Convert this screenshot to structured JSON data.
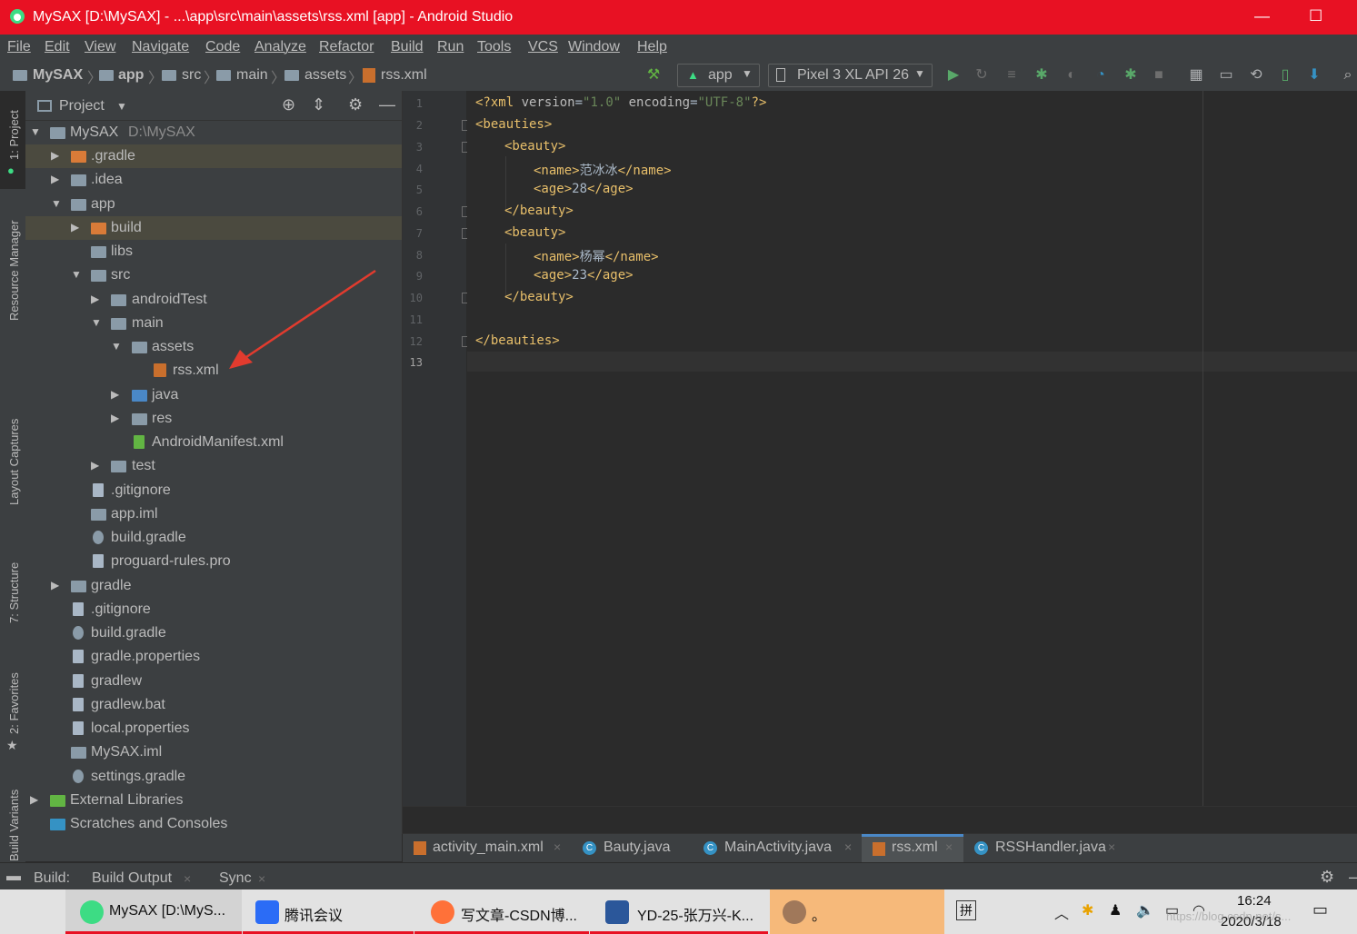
{
  "window": {
    "title": "MySAX [D:\\MySAX] - ...\\app\\src\\main\\assets\\rss.xml [app] - Android Studio",
    "minimize": "—",
    "maximize": "☐"
  },
  "menu": [
    "File",
    "Edit",
    "View",
    "Navigate",
    "Code",
    "Analyze",
    "Refactor",
    "Build",
    "Run",
    "Tools",
    "VCS",
    "Window",
    "Help"
  ],
  "breadcrumbs": [
    "MySAX",
    "app",
    "src",
    "main",
    "assets",
    "rss.xml"
  ],
  "toolbar": {
    "config": "app",
    "device": "Pixel 3 XL API 26"
  },
  "left_strip": [
    "1: Project",
    "Resource Manager",
    "Layout Captures",
    "7: Structure",
    "2: Favorites",
    "Build Variants"
  ],
  "project_panel": {
    "title": "Project"
  },
  "tree": [
    {
      "label": "MySAX",
      "sub": "D:\\MySAX",
      "arrow": "▼"
    },
    {
      "label": ".gradle",
      "arrow": "▶"
    },
    {
      "label": ".idea",
      "arrow": "▶"
    },
    {
      "label": "app",
      "arrow": "▼"
    },
    {
      "label": "build",
      "arrow": "▶"
    },
    {
      "label": "libs",
      "arrow": ""
    },
    {
      "label": "src",
      "arrow": "▼"
    },
    {
      "label": "androidTest",
      "arrow": "▶"
    },
    {
      "label": "main",
      "arrow": "▼"
    },
    {
      "label": "assets",
      "arrow": "▼"
    },
    {
      "label": "rss.xml",
      "arrow": ""
    },
    {
      "label": "java",
      "arrow": "▶"
    },
    {
      "label": "res",
      "arrow": "▶"
    },
    {
      "label": "AndroidManifest.xml",
      "arrow": ""
    },
    {
      "label": "test",
      "arrow": "▶"
    },
    {
      "label": ".gitignore",
      "arrow": ""
    },
    {
      "label": "app.iml",
      "arrow": ""
    },
    {
      "label": "build.gradle",
      "arrow": ""
    },
    {
      "label": "proguard-rules.pro",
      "arrow": ""
    },
    {
      "label": "gradle",
      "arrow": "▶"
    },
    {
      "label": ".gitignore",
      "arrow": ""
    },
    {
      "label": "build.gradle",
      "arrow": ""
    },
    {
      "label": "gradle.properties",
      "arrow": ""
    },
    {
      "label": "gradlew",
      "arrow": ""
    },
    {
      "label": "gradlew.bat",
      "arrow": ""
    },
    {
      "label": "local.properties",
      "arrow": ""
    },
    {
      "label": "MySAX.iml",
      "arrow": ""
    },
    {
      "label": "settings.gradle",
      "arrow": ""
    },
    {
      "label": "External Libraries",
      "arrow": "▶"
    },
    {
      "label": "Scratches and Consoles",
      "arrow": ""
    }
  ],
  "editor": {
    "line_numbers": [
      "1",
      "2",
      "3",
      "4",
      "5",
      "6",
      "7",
      "8",
      "9",
      "10",
      "11",
      "12",
      "13"
    ],
    "xml_decl": {
      "open": "<?xml ",
      "k1": "version",
      "eq": "=",
      "v1": "\"1.0\"",
      "k2": "encoding",
      "v2": "\"UTF-8\"",
      "close": "?>"
    },
    "lines": {
      "l2": "<beauties>",
      "l3": "<beauty>",
      "l4_open": "<name>",
      "l4_text": "范冰冰",
      "l4_close": "</name>",
      "l5_open": "<age>",
      "l5_text": "28",
      "l5_close": "</age>",
      "l6": "</beauty>",
      "l7": "<beauty>",
      "l8_open": "<name>",
      "l8_text": "杨幂",
      "l8_close": "</name>",
      "l9_open": "<age>",
      "l9_text": "23",
      "l9_close": "</age>",
      "l10": "</beauty>",
      "l12": "</beauties>"
    }
  },
  "tabs": [
    "activity_main.xml",
    "Bauty.java",
    "MainActivity.java",
    "rss.xml",
    "RSSHandler.java"
  ],
  "tab_close": "×",
  "build_bar": {
    "build": "Build:",
    "output": "Build Output",
    "sync": "Sync"
  },
  "taskbar": {
    "items": [
      "MySAX [D:\\MyS...",
      "腾讯会议",
      "写文章-CSDN博...",
      "YD-25-张万兴-K...",
      "。"
    ],
    "ime": "拼",
    "time": "16:24",
    "date": "2020/3/18",
    "watermark": "https://blog.csdn.net/s..."
  },
  "colors": {
    "titlebar": "#e81123",
    "panel": "#3c3f41",
    "editor": "#2b2b2b",
    "tag": "#e8bf6a",
    "string": "#6a8759",
    "selected": "#4b4a3f",
    "arrow": "#e23b2e"
  }
}
